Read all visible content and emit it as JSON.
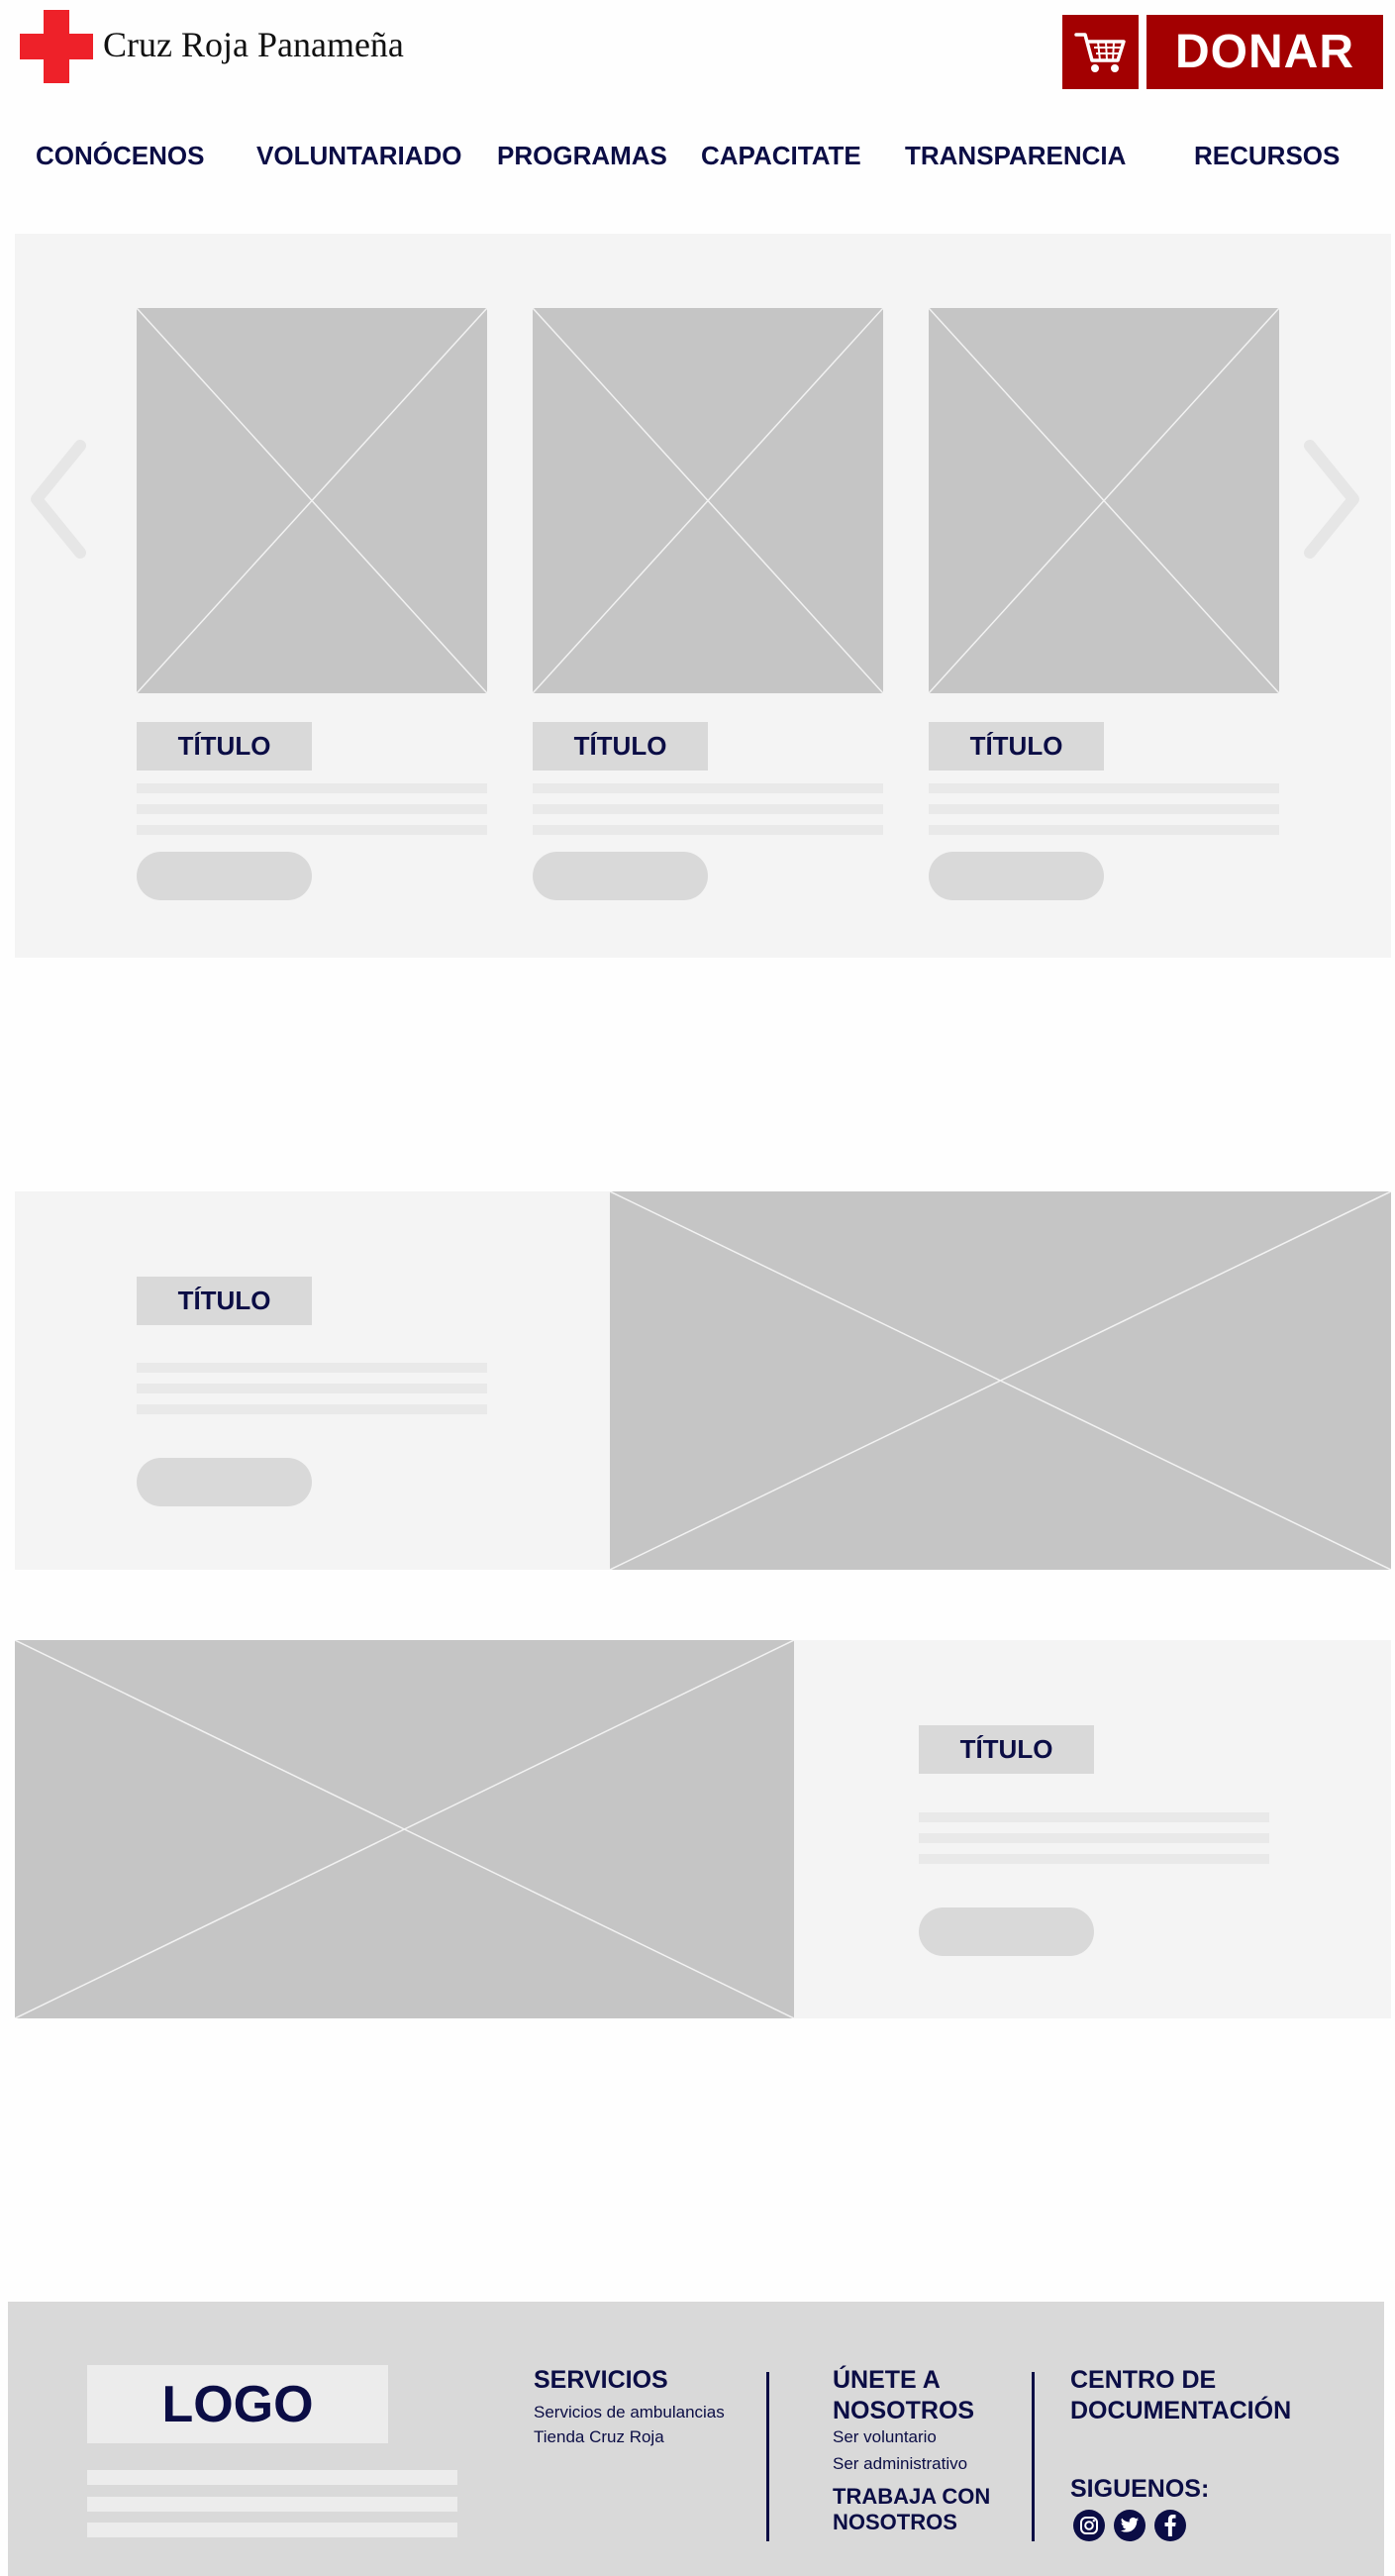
{
  "header": {
    "brand": "Cruz Roja Panameña",
    "cart_icon": "shopping-cart-icon",
    "donate_label": "DONAR",
    "accent_color": "#a30001",
    "cross_color": "#ee2129"
  },
  "nav": {
    "items": [
      {
        "label": "CONÓCENOS"
      },
      {
        "label": "VOLUNTARIADO"
      },
      {
        "label": "PROGRAMAS"
      },
      {
        "label": "CAPACITATE"
      },
      {
        "label": "TRANSPARENCIA"
      },
      {
        "label": "RECURSOS"
      }
    ]
  },
  "carousel": {
    "prev_icon": "chevron-left-icon",
    "next_icon": "chevron-right-icon",
    "cards": [
      {
        "title": "TÍTULO"
      },
      {
        "title": "TÍTULO"
      },
      {
        "title": "TÍTULO"
      }
    ]
  },
  "feature_left": {
    "title": "TÍTULO"
  },
  "feature_right": {
    "title": "TÍTULO"
  },
  "footer": {
    "logo_label": "LOGO",
    "servicios": {
      "heading": "SERVICIOS",
      "links": [
        "Servicios de ambulancias",
        "Tienda Cruz Roja"
      ]
    },
    "unete": {
      "heading_line1": "ÚNETE A",
      "heading_line2": "NOSOTROS",
      "links": [
        "Ser voluntario",
        "Ser administrativo"
      ],
      "trabaja_line1": "TRABAJA CON",
      "trabaja_line2": "NOSOTROS"
    },
    "centro": {
      "heading_line1": "CENTRO DE",
      "heading_line2": "DOCUMENTACIÓN"
    },
    "siguenos": {
      "heading": "SIGUENOS:",
      "icons": [
        "instagram-icon",
        "twitter-icon",
        "facebook-icon"
      ]
    }
  }
}
